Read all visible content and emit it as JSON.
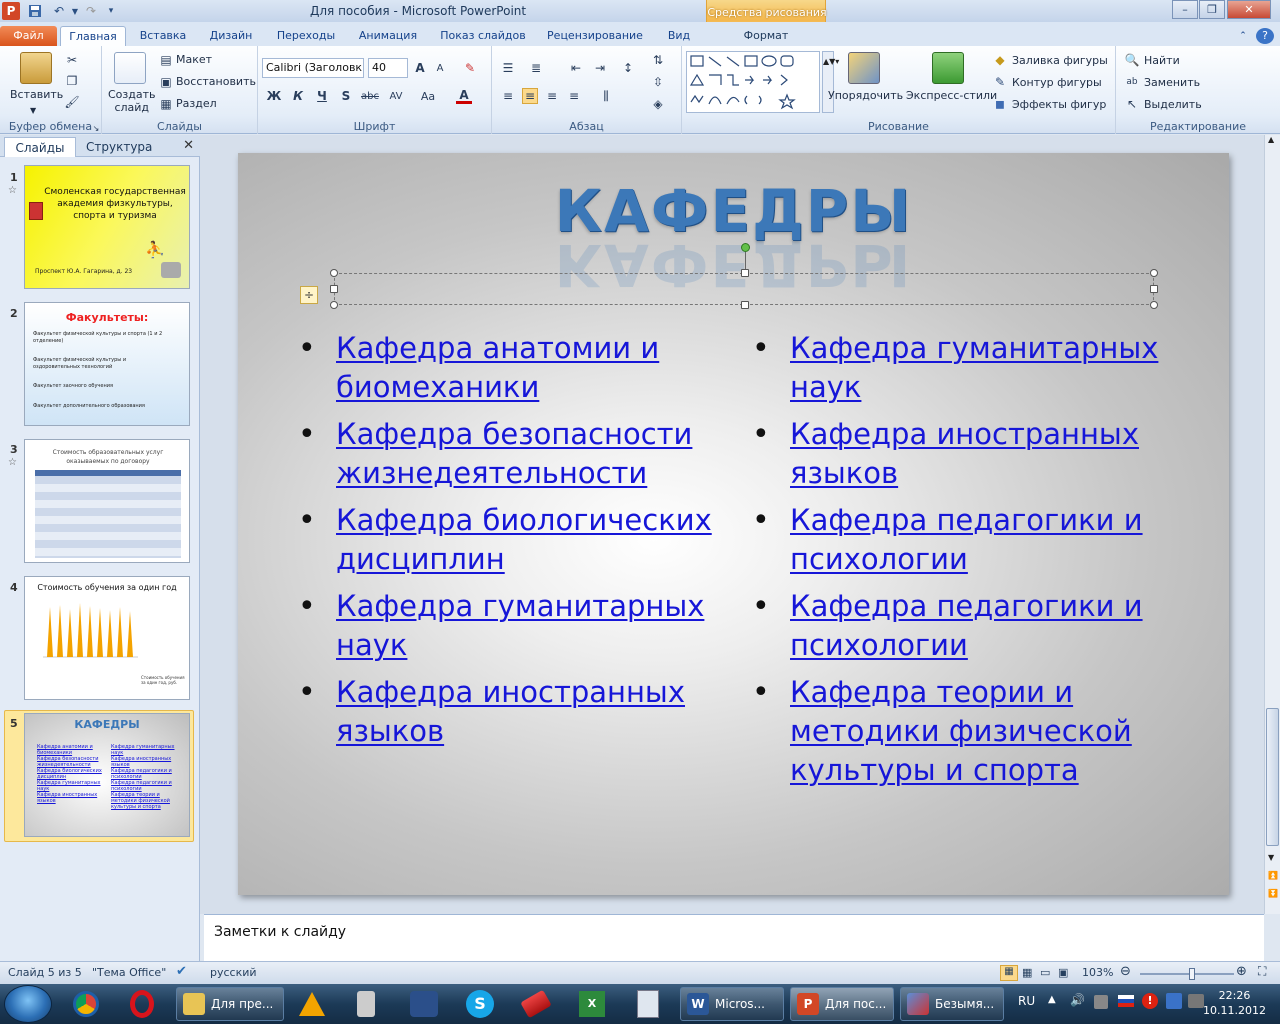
{
  "window": {
    "title": "Для пособия - Microsoft PowerPoint",
    "app_icon": "P",
    "minimize": "–",
    "restore": "❐",
    "close": "✕"
  },
  "qat": {
    "save_icon": "save-icon",
    "undo_icon": "undo-icon",
    "redo_icon": "redo-icon"
  },
  "ribbon": {
    "tabs": [
      "Файл",
      "Главная",
      "Вставка",
      "Дизайн",
      "Переходы",
      "Анимация",
      "Показ слайдов",
      "Рецензирование",
      "Вид"
    ],
    "context_group": "Средства рисования",
    "context_tab": "Формат",
    "help": "?",
    "clipboard": {
      "paste": "Вставить",
      "label": "Буфер обмена"
    },
    "slides": {
      "new_slide": "Создать слайд",
      "layout": "Макет",
      "reset": "Восстановить",
      "section": "Раздел",
      "label": "Слайды"
    },
    "font": {
      "family": "Calibri (Заголовк",
      "size": "40",
      "bold": "Ж",
      "italic": "К",
      "underline": "Ч",
      "shadow": "S",
      "strike": "abc",
      "spacing": "AV",
      "case": "Aa",
      "color": "A",
      "grow": "A",
      "shrink": "A",
      "label": "Шрифт"
    },
    "paragraph": {
      "label": "Абзац"
    },
    "drawing": {
      "arrange": "Упорядочить",
      "quick_styles": "Экспресс-стили",
      "fill": "Заливка фигуры",
      "outline": "Контур фигуры",
      "effects": "Эффекты фигур",
      "label": "Рисование"
    },
    "editing": {
      "find": "Найти",
      "replace": "Заменить",
      "select": "Выделить",
      "label": "Редактирование"
    }
  },
  "pane": {
    "tab_slides": "Слайды",
    "tab_outline": "Структура",
    "close": "✕"
  },
  "thumbnails": [
    {
      "num": "1",
      "title": "Смоленская государственная академия физкультуры, спорта и туризма",
      "footer": "Проспект Ю.А. Гагарина, д. 23"
    },
    {
      "num": "2",
      "title": "Факультеты:",
      "items": [
        "Факультет физической культуры и спорта (1 и 2 отделение)",
        "Факультет физической культуры и оздоровительных технологий",
        "Факультет заочного обучения",
        "Факультет дополнительного образования"
      ]
    },
    {
      "num": "3",
      "title": "Стоимость образовательных услуг оказываемых по договору"
    },
    {
      "num": "4",
      "title": "Стоимость обучения за один год",
      "legend": "Стоимость обучения за один год, руб."
    },
    {
      "num": "5",
      "title": "КАФЕДРЫ"
    }
  ],
  "slide": {
    "title": "КАФЕДРЫ",
    "left_items": [
      "Кафедра анатомии и биомеханики",
      "Кафедра безопасности жизнедеятельности",
      "Кафедра биологических дисциплин",
      "Кафедра гуманитарных наук",
      "Кафедра иностранных языков"
    ],
    "right_items": [
      "Кафедра гуманитарных наук",
      "Кафедра иностранных языков",
      "Кафедра педагогики и психологии",
      "Кафедра педагогики и психологии",
      "Кафедра теории и методики физической культуры и спорта"
    ]
  },
  "notes": {
    "placeholder": "Заметки к слайду"
  },
  "status": {
    "slide_of": "Слайд 5 из 5",
    "theme": "\"Тема Office\"",
    "language": "русский",
    "zoom": "103%",
    "zoom_fraction": 0.55
  },
  "taskbar": {
    "tasks": [
      {
        "label": "Для пре..."
      },
      {
        "label": "Micros..."
      },
      {
        "label": "Для пос..."
      },
      {
        "label": "Безымя..."
      }
    ],
    "lang": "RU",
    "time": "22:26",
    "date": "10.11.2012"
  }
}
